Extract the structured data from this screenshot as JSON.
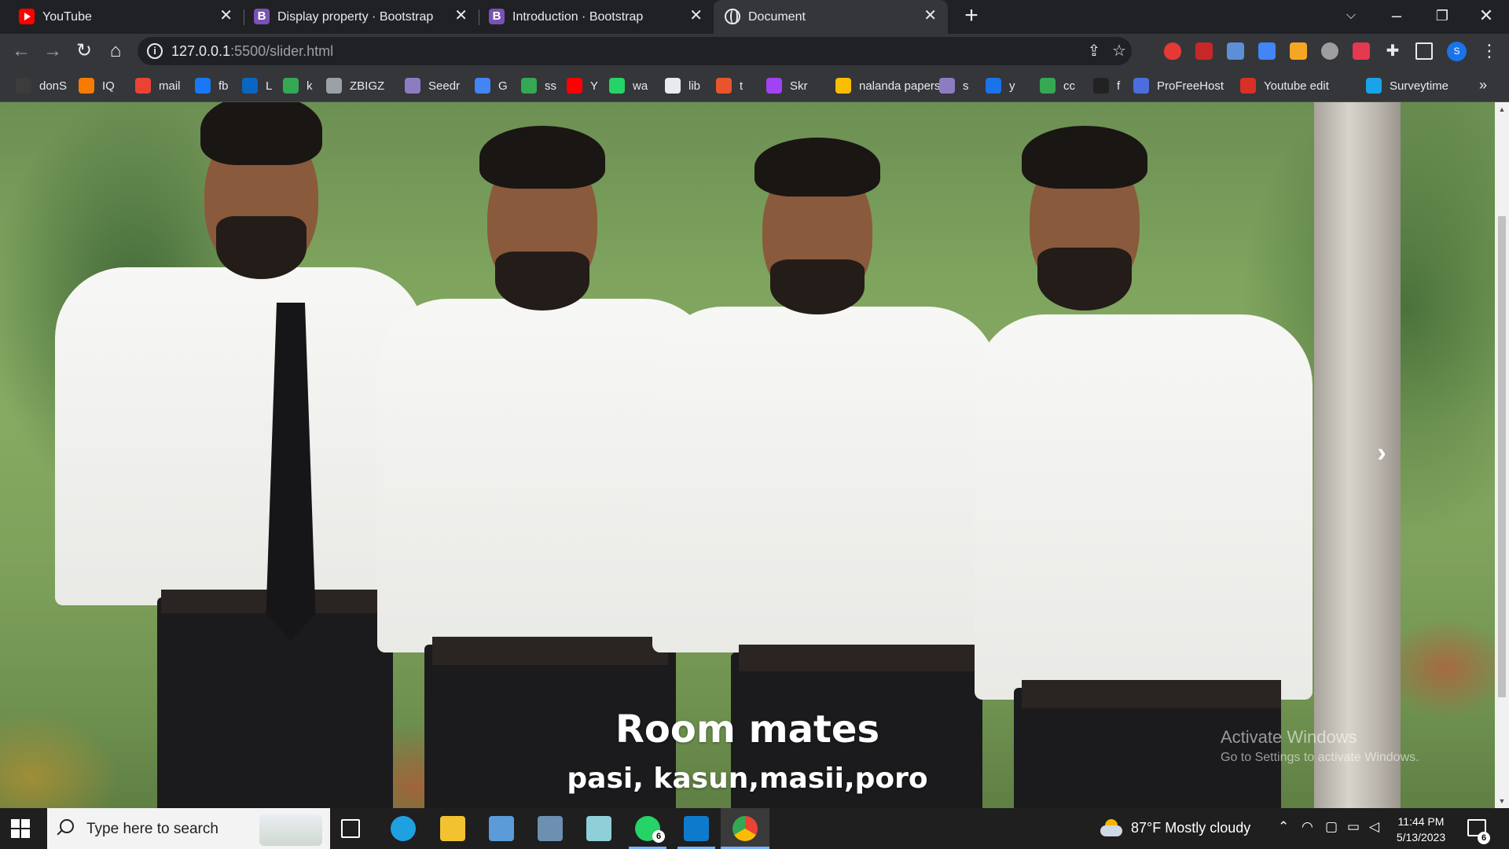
{
  "browser": {
    "tabs": [
      {
        "title": "YouTube",
        "favicon": "youtube-icon",
        "active": false
      },
      {
        "title": "Display property · Bootstrap",
        "favicon": "bootstrap-icon",
        "active": false
      },
      {
        "title": "Introduction · Bootstrap",
        "favicon": "bootstrap-icon",
        "active": false
      },
      {
        "title": "Document",
        "favicon": "globe-icon",
        "active": true
      }
    ],
    "close_glyph": "✕",
    "new_tab_glyph": "+",
    "address": {
      "host": "127.0.0.1",
      "path": ":5500/slider.html"
    },
    "profile_initial": "S"
  },
  "bookmarks": [
    {
      "label": "donS",
      "color": "#3c3c3c"
    },
    {
      "label": "IQ",
      "color": "#f57c00"
    },
    {
      "label": "mail",
      "color": "#ea4335"
    },
    {
      "label": "fb",
      "color": "#1877f2"
    },
    {
      "label": "L",
      "color": "#0a66c2"
    },
    {
      "label": "k",
      "color": "#34a853"
    },
    {
      "label": "ZBIGZ",
      "color": "#9aa0a6"
    },
    {
      "label": "Seedr",
      "color": "#8e7cc3"
    },
    {
      "label": "G",
      "color": "#4285f4"
    },
    {
      "label": "ss",
      "color": "#34a853"
    },
    {
      "label": "Y",
      "color": "#ff0000"
    },
    {
      "label": "wa",
      "color": "#25d366"
    },
    {
      "label": "lib",
      "color": "#e8eaed"
    },
    {
      "label": "t",
      "color": "#e8552d"
    },
    {
      "label": "Skr",
      "color": "#a142f4"
    },
    {
      "label": "nalanda papers",
      "color": "#fbbc04"
    },
    {
      "label": "s",
      "color": "#8e7cc3"
    },
    {
      "label": "y",
      "color": "#1a73e8"
    },
    {
      "label": "cc",
      "color": "#34a853"
    },
    {
      "label": "f",
      "color": "#222222"
    },
    {
      "label": "ProFreeHost",
      "color": "#4a6ee0"
    },
    {
      "label": "Youtube edit",
      "color": "#d93025"
    },
    {
      "label": "Surveytime",
      "color": "#1aa3e8"
    }
  ],
  "carousel": {
    "caption_title": "Room mates",
    "caption_text": "pasi, kasun,masii,poro",
    "next_glyph": "›"
  },
  "watermark": {
    "line1": "Activate Windows",
    "line2": "Go to Settings to activate Windows."
  },
  "taskbar": {
    "search_placeholder": "Type here to search",
    "whatsapp_badge": "6",
    "weather": "87°F  Mostly cloudy",
    "time": "11:44 PM",
    "date": "5/13/2023",
    "notification_count": "6"
  }
}
